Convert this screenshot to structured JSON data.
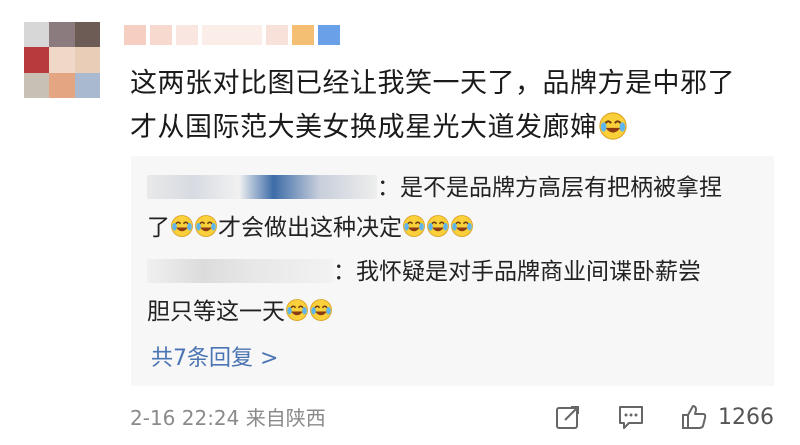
{
  "comment": {
    "text_line1": "这两张对比图已经让我笑一天了，品牌方是中邪了",
    "text_line2": "才从国际范大美女换成星光大道发廊婶",
    "emoji": "laugh-cry-emoji"
  },
  "replies": [
    {
      "text_a": "：是不是品牌方高层有把柄被拿捏",
      "text_b_pre": "了",
      "text_b_mid": "才会做出这种决定"
    },
    {
      "text_a": "：我怀疑是对手品牌商业间谍卧薪尝",
      "text_b": "胆只等这一天"
    }
  ],
  "reply_count_label": "共7条回复 >",
  "footer": {
    "meta": "2-16 22:24 来自陕西",
    "like_count": "1266"
  },
  "icons": {
    "share": "share-icon",
    "comment": "comment-icon",
    "like": "thumbs-up-icon"
  },
  "colors": {
    "link": "#4b74b3",
    "meta": "#8a8a8a",
    "reply_bg": "#f7f7f7"
  }
}
